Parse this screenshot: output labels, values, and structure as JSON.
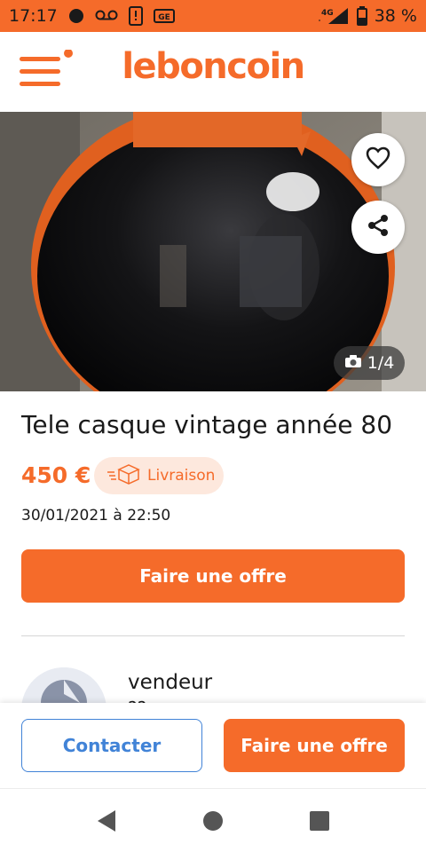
{
  "status_bar": {
    "time": "17:17",
    "battery": "38 %",
    "network": "4G"
  },
  "header": {
    "logo": "leboncoin",
    "menu_icon": "hamburger-menu-icon",
    "accent_color": "#f56b2a"
  },
  "gallery": {
    "counter": "1/4",
    "favorite_icon": "heart-icon",
    "share_icon": "share-icon",
    "camera_icon": "camera-icon"
  },
  "listing": {
    "title": "Tele casque vintage année 80",
    "price": "450 €",
    "delivery_label": "Livraison",
    "date": "30/01/2021 à 22:50",
    "offer_button": "Faire une offre"
  },
  "seller": {
    "name": "vendeur",
    "sub": "??"
  },
  "bottom_bar": {
    "contact_label": "Contacter",
    "offer_label": "Faire une offre"
  },
  "nav": {
    "back_icon": "back-triangle-icon",
    "home_icon": "home-circle-icon",
    "recents_icon": "recents-square-icon"
  }
}
